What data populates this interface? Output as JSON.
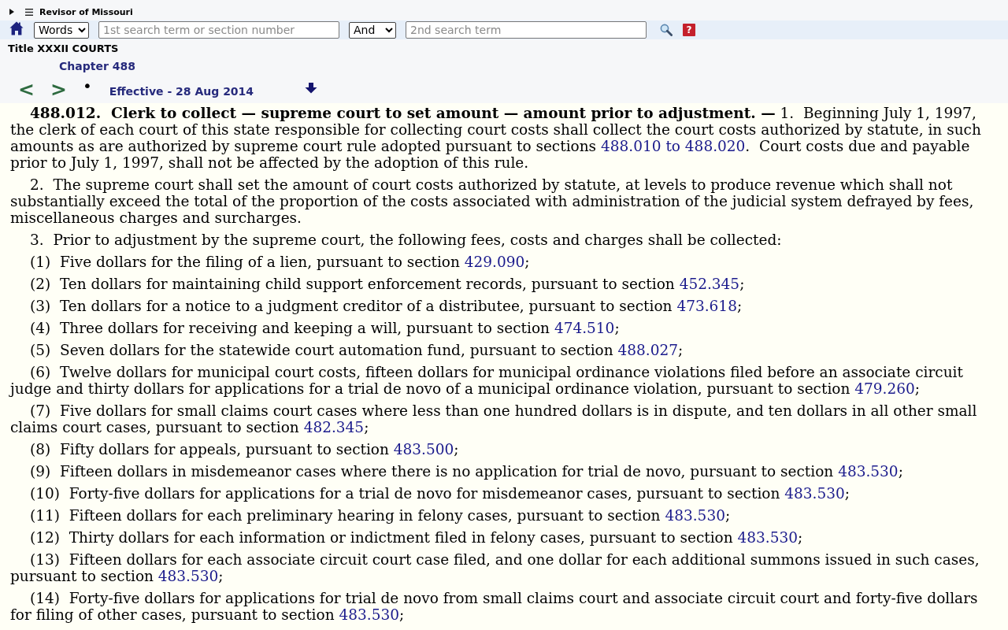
{
  "header": {
    "site_title": "Revisor of Missouri"
  },
  "search_bar": {
    "mode": "Words",
    "term1": {
      "placeholder": "1st search term or section number"
    },
    "operator": "And",
    "term2": {
      "placeholder": "2nd search term"
    },
    "help": "?"
  },
  "breadcrumb": {
    "title": "Title XXXII COURTS",
    "chapter": "Chapter 488"
  },
  "nav": {
    "previous": "<",
    "next": ">",
    "bullet": "•",
    "effective": "Effective - 28 Aug 2014"
  },
  "content": {
    "paragraphs": [
      {
        "parts": [
          {
            "kind": "bold",
            "text": "488.012.  Clerk to collect — supreme court to set amount — amount prior to adjustment. —"
          },
          {
            "kind": "text",
            "text": " 1.  Beginning July 1, 1997, the clerk of each court of this state responsible for collecting court costs shall collect the court costs authorized by statute, in such amounts as are authorized by supreme court rule adopted pursuant to sections "
          },
          {
            "kind": "link",
            "text": "488.010 to 488.020"
          },
          {
            "kind": "text",
            "text": ".  Court costs due and payable prior to July 1, 1997, shall not be affected by the adoption of this rule."
          }
        ]
      },
      {
        "parts": [
          {
            "kind": "text",
            "text": "2.  The supreme court shall set the amount of court costs authorized by statute, at levels to produce revenue which shall not substantially exceed the total of the proportion of the costs associated with administration of the judicial system defrayed by fees, miscellaneous charges and surcharges."
          }
        ]
      },
      {
        "parts": [
          {
            "kind": "text",
            "text": "3.  Prior to adjustment by the supreme court, the following fees, costs and charges shall be collected:"
          }
        ]
      },
      {
        "parts": [
          {
            "kind": "text",
            "text": "(1)  Five dollars for the filing of a lien, pursuant to section "
          },
          {
            "kind": "link",
            "text": "429.090"
          },
          {
            "kind": "text",
            "text": ";"
          }
        ]
      },
      {
        "parts": [
          {
            "kind": "text",
            "text": "(2)  Ten dollars for maintaining child support enforcement records, pursuant to section "
          },
          {
            "kind": "link",
            "text": "452.345"
          },
          {
            "kind": "text",
            "text": ";"
          }
        ]
      },
      {
        "parts": [
          {
            "kind": "text",
            "text": "(3)  Ten dollars for a notice to a judgment creditor of a distributee, pursuant to section "
          },
          {
            "kind": "link",
            "text": "473.618"
          },
          {
            "kind": "text",
            "text": ";"
          }
        ]
      },
      {
        "parts": [
          {
            "kind": "text",
            "text": "(4)  Three dollars for receiving and keeping a will, pursuant to section "
          },
          {
            "kind": "link",
            "text": "474.510"
          },
          {
            "kind": "text",
            "text": ";"
          }
        ]
      },
      {
        "parts": [
          {
            "kind": "text",
            "text": "(5)  Seven dollars for the statewide court automation fund, pursuant to section "
          },
          {
            "kind": "link",
            "text": "488.027"
          },
          {
            "kind": "text",
            "text": ";"
          }
        ]
      },
      {
        "parts": [
          {
            "kind": "text",
            "text": "(6)  Twelve dollars for municipal court costs, fifteen dollars for municipal ordinance violations filed before an associate circuit judge and thirty dollars for applications for a trial de novo of a municipal ordinance violation, pursuant to section "
          },
          {
            "kind": "link",
            "text": "479.260"
          },
          {
            "kind": "text",
            "text": ";"
          }
        ]
      },
      {
        "parts": [
          {
            "kind": "text",
            "text": "(7)  Five dollars for small claims court cases where less than one hundred dollars is in dispute, and ten dollars in all other small claims court cases, pursuant to section "
          },
          {
            "kind": "link",
            "text": "482.345"
          },
          {
            "kind": "text",
            "text": ";"
          }
        ]
      },
      {
        "parts": [
          {
            "kind": "text",
            "text": "(8)  Fifty dollars for appeals, pursuant to section "
          },
          {
            "kind": "link",
            "text": "483.500"
          },
          {
            "kind": "text",
            "text": ";"
          }
        ]
      },
      {
        "parts": [
          {
            "kind": "text",
            "text": "(9)  Fifteen dollars in misdemeanor cases where there is no application for trial de novo, pursuant to section "
          },
          {
            "kind": "link",
            "text": "483.530"
          },
          {
            "kind": "text",
            "text": ";"
          }
        ]
      },
      {
        "parts": [
          {
            "kind": "text",
            "text": "(10)  Forty-five dollars for applications for a trial de novo for misdemeanor cases, pursuant to section "
          },
          {
            "kind": "link",
            "text": "483.530"
          },
          {
            "kind": "text",
            "text": ";"
          }
        ]
      },
      {
        "parts": [
          {
            "kind": "text",
            "text": "(11)  Fifteen dollars for each preliminary hearing in felony cases, pursuant to section "
          },
          {
            "kind": "link",
            "text": "483.530"
          },
          {
            "kind": "text",
            "text": ";"
          }
        ]
      },
      {
        "parts": [
          {
            "kind": "text",
            "text": "(12)  Thirty dollars for each information or indictment filed in felony cases, pursuant to section "
          },
          {
            "kind": "link",
            "text": "483.530"
          },
          {
            "kind": "text",
            "text": ";"
          }
        ]
      },
      {
        "parts": [
          {
            "kind": "text",
            "text": "(13)  Fifteen dollars for each associate circuit court case filed, and one dollar for each additional summons issued in such cases, pursuant to section "
          },
          {
            "kind": "link",
            "text": "483.530"
          },
          {
            "kind": "text",
            "text": ";"
          }
        ]
      },
      {
        "parts": [
          {
            "kind": "text",
            "text": "(14)  Forty-five dollars for applications for trial de novo from small claims court and associate circuit court and forty-five dollars for filing of other cases, pursuant to section "
          },
          {
            "kind": "link",
            "text": "483.530"
          },
          {
            "kind": "text",
            "text": ";"
          }
        ]
      }
    ]
  }
}
